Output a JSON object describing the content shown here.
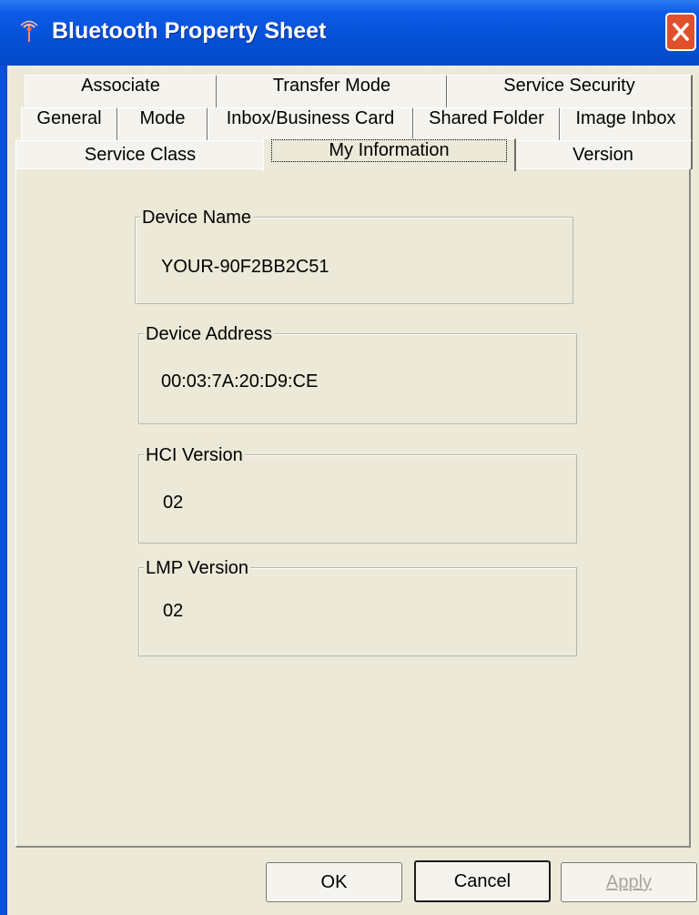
{
  "window": {
    "title": "Bluetooth Property Sheet"
  },
  "tabs": {
    "row1": [
      "Associate",
      "Transfer Mode",
      "Service Security"
    ],
    "row2": [
      "General",
      "Mode",
      "Inbox/Business Card",
      "Shared Folder",
      "Image Inbox"
    ],
    "row3": [
      "Service Class",
      "My Information",
      "Version"
    ],
    "selected": "My Information"
  },
  "groups": {
    "device_name": {
      "label": "Device Name",
      "value": "YOUR-90F2BB2C51"
    },
    "device_address": {
      "label": "Device Address",
      "value": "00:03:7A:20:D9:CE"
    },
    "hci_version": {
      "label": "HCI Version",
      "value": "02"
    },
    "lmp_version": {
      "label": "LMP Version",
      "value": "02"
    }
  },
  "buttons": {
    "ok": "OK",
    "cancel": "Cancel",
    "apply": "Apply"
  },
  "colors": {
    "titlebar": "#0450d6",
    "face": "#ece9d8",
    "close": "#e0502a"
  }
}
